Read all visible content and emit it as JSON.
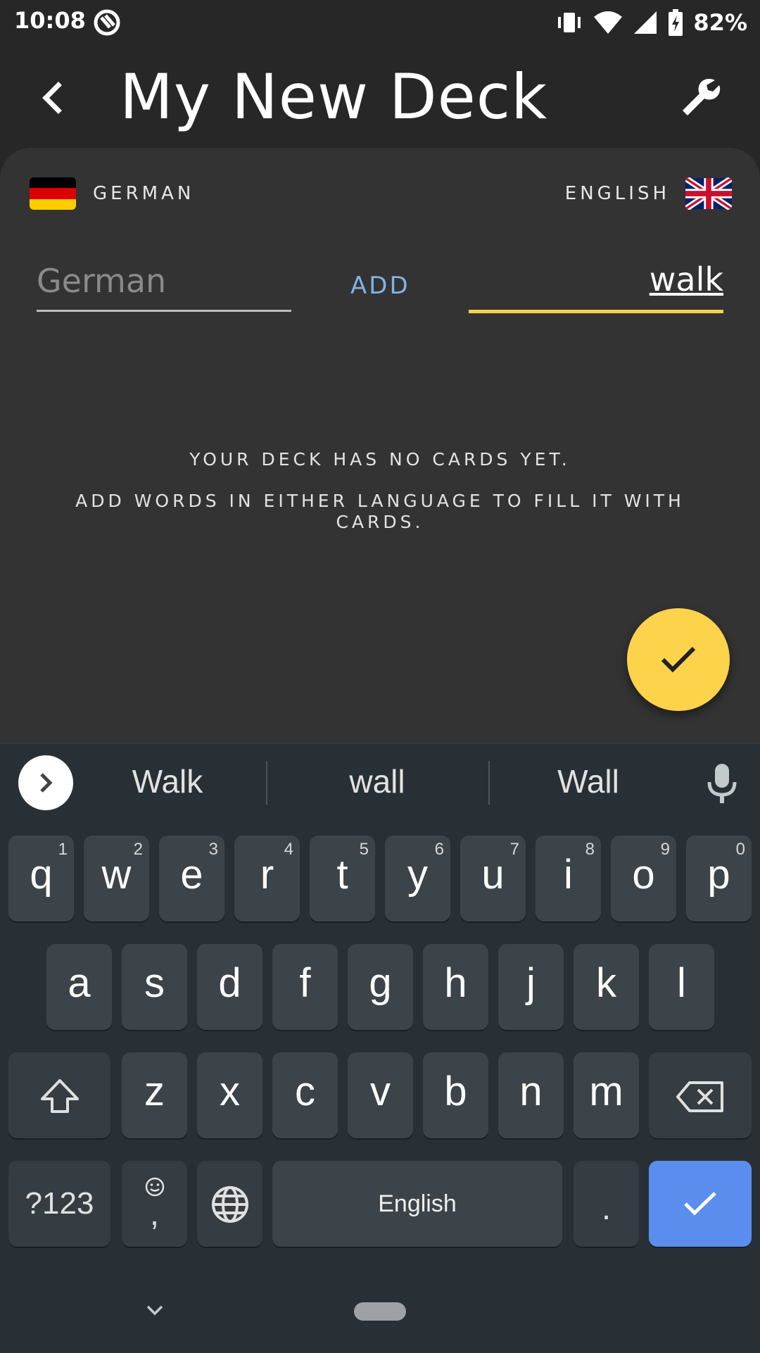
{
  "status_bar": {
    "time": "10:08",
    "battery": "82%",
    "icons": [
      "app-notification-icon",
      "vibrate-icon",
      "wifi-icon",
      "signal-icon",
      "battery-charging-icon"
    ]
  },
  "app_bar": {
    "title": "My New Deck",
    "back_icon": "back-arrow-icon",
    "settings_icon": "wrench-icon"
  },
  "languages": {
    "source": {
      "label": "GERMAN",
      "flag": "germany-flag-icon"
    },
    "target": {
      "label": "ENGLISH",
      "flag": "uk-flag-icon"
    }
  },
  "input": {
    "left_placeholder": "German",
    "left_value": "",
    "add_label": "ADD",
    "right_value": "walk"
  },
  "empty_state": {
    "line1": "YOUR DECK HAS NO CARDS YET.",
    "line2": "ADD WORDS IN EITHER LANGUAGE TO FILL IT WITH CARDS."
  },
  "fab_icon": "check-icon",
  "colors": {
    "accent": "#fdd34b",
    "link": "#80b2e6",
    "background": "#272727",
    "card": "#333333",
    "keyboard": "#283036",
    "enter": "#5b8def"
  },
  "keyboard": {
    "suggestions": [
      "Walk",
      "wall",
      "Wall"
    ],
    "row1": [
      {
        "ch": "q",
        "num": "1"
      },
      {
        "ch": "w",
        "num": "2"
      },
      {
        "ch": "e",
        "num": "3"
      },
      {
        "ch": "r",
        "num": "4"
      },
      {
        "ch": "t",
        "num": "5"
      },
      {
        "ch": "y",
        "num": "6"
      },
      {
        "ch": "u",
        "num": "7"
      },
      {
        "ch": "i",
        "num": "8"
      },
      {
        "ch": "o",
        "num": "9"
      },
      {
        "ch": "p",
        "num": "0"
      }
    ],
    "row2": [
      "a",
      "s",
      "d",
      "f",
      "g",
      "h",
      "j",
      "k",
      "l"
    ],
    "row3": [
      "z",
      "x",
      "c",
      "v",
      "b",
      "n",
      "m"
    ],
    "symbols_label": "?123",
    "comma_label": ",",
    "space_label": "English",
    "period_label": "."
  }
}
